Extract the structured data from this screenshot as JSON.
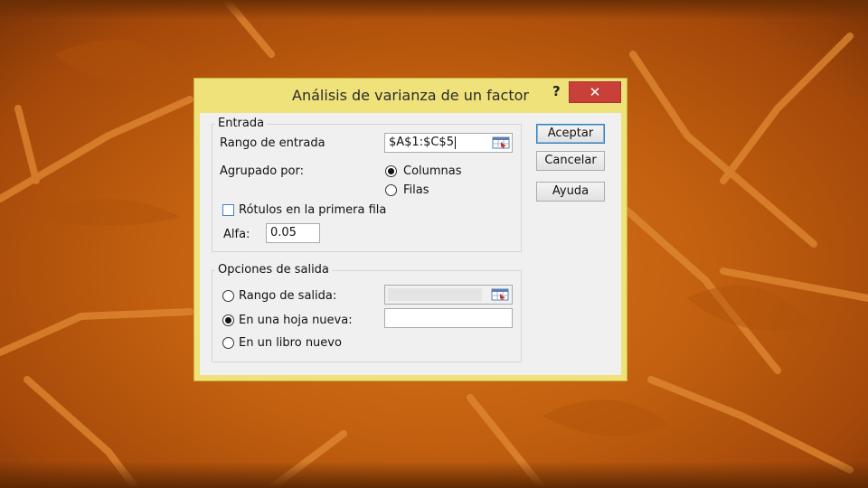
{
  "dialog": {
    "title": "Análisis de varianza de un factor",
    "help_label": "?",
    "close_label": "✕"
  },
  "input_group": {
    "title": "Entrada",
    "range_label": "Rango de entrada",
    "range_value": "$A$1:$C$5",
    "grouped_by_label": "Agrupado por:",
    "columns_label": "Columnas",
    "rows_label": "Filas",
    "grouped_by_selected": "Columnas",
    "labels_checkbox_label": "Rótulos en la primera fila",
    "labels_checked": false,
    "alpha_label": "Alfa:",
    "alpha_value": "0.05"
  },
  "output_group": {
    "title": "Opciones de salida",
    "output_range_label": "Rango de salida:",
    "new_sheet_label": "En una hoja nueva:",
    "new_book_label": "En un libro nuevo",
    "selected": "En una hoja nueva:",
    "output_range_value": "",
    "new_sheet_value": ""
  },
  "buttons": {
    "ok": "Aceptar",
    "cancel": "Cancelar",
    "help": "Ayuda"
  },
  "colors": {
    "titlebar": "#f0e27a",
    "close": "#c9403a",
    "background": "#c2600f"
  },
  "icons": [
    "range-selector-icon"
  ]
}
